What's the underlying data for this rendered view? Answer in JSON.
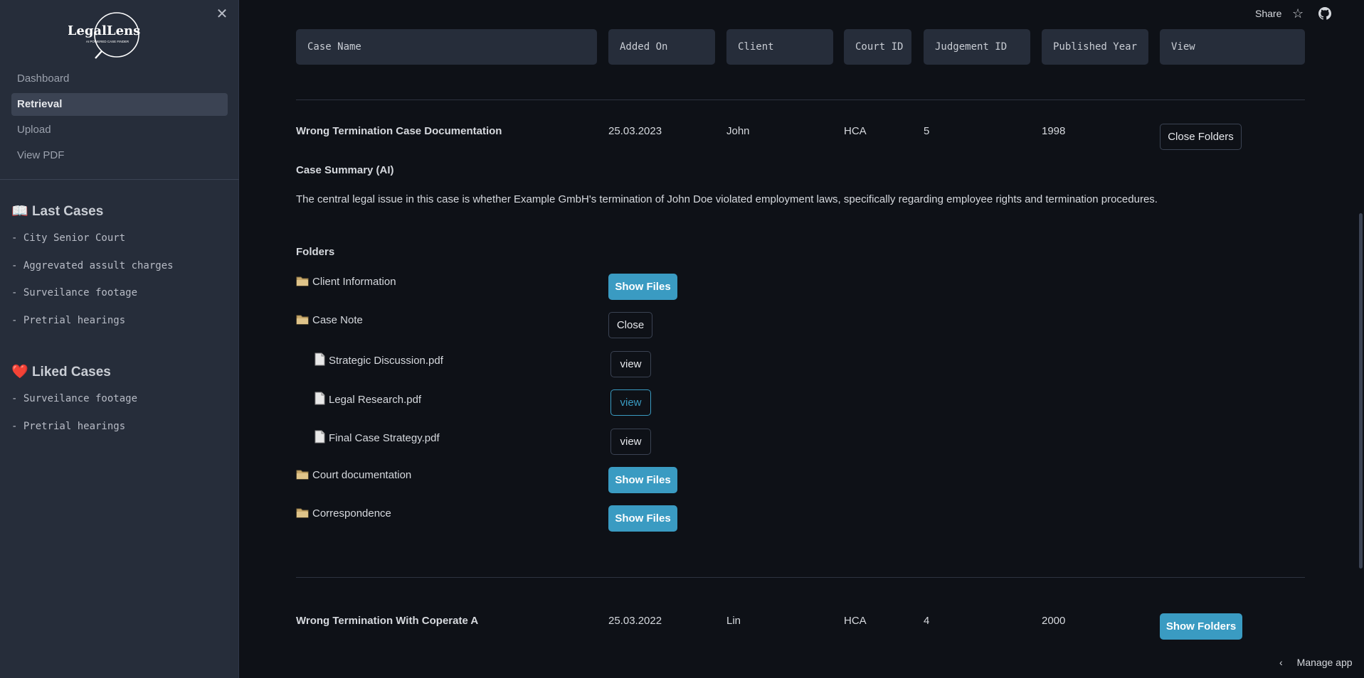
{
  "sidebar": {
    "logo_text": "LegalLens",
    "logo_tagline": "AI POWERED CASE FINDER",
    "nav": [
      {
        "label": "Dashboard",
        "active": false
      },
      {
        "label": "Retrieval",
        "active": true
      },
      {
        "label": "Upload",
        "active": false
      },
      {
        "label": "View PDF",
        "active": false
      }
    ],
    "last_cases_title": "Last Cases",
    "last_cases_icon": "📖",
    "last_cases": [
      "- City Senior Court",
      "- Aggrevated assult charges",
      "- Surveilance footage",
      "- Pretrial hearings"
    ],
    "liked_cases_title": "Liked Cases",
    "liked_cases_icon": "❤️",
    "liked_cases": [
      "- Surveilance footage",
      "- Pretrial hearings"
    ]
  },
  "topbar": {
    "share": "Share"
  },
  "table": {
    "headers": [
      "Case Name",
      "Added On",
      "Client",
      "Court ID",
      "Judgement ID",
      "Published Year",
      "View"
    ],
    "rows": [
      {
        "case_name": "Wrong Termination Case Documentation",
        "added_on": "25.03.2023",
        "client": "John",
        "court_id": "HCA",
        "judgement_id": "5",
        "published_year": "1998",
        "button": "Close Folders"
      },
      {
        "case_name": "Wrong Termination With Coperate A",
        "added_on": "25.03.2022",
        "client": "Lin",
        "court_id": "HCA",
        "judgement_id": "4",
        "published_year": "2000",
        "button": "Show Folders"
      }
    ]
  },
  "summary": {
    "title": "Case Summary (AI)",
    "text": "The central legal issue in this case is whether Example GmbH's termination of John Doe violated employment laws, specifically regarding employee rights and termination procedures."
  },
  "folders": {
    "title": "Folders",
    "items": [
      {
        "name": "Client Information",
        "button": "Show Files"
      },
      {
        "name": "Case Note",
        "button": "Close"
      },
      {
        "name": "Court documentation",
        "button": "Show Files"
      },
      {
        "name": "Correspondence",
        "button": "Show Files"
      }
    ],
    "files": [
      {
        "name": "Strategic Discussion.pdf",
        "button": "view"
      },
      {
        "name": "Legal Research.pdf",
        "button": "view"
      },
      {
        "name": "Final Case Strategy.pdf",
        "button": "view"
      }
    ]
  },
  "footer": {
    "manage_app": "Manage app"
  },
  "colors": {
    "accent": "#3a9bc2",
    "sidebar_bg": "#262d3a",
    "main_bg": "#0e1117"
  }
}
